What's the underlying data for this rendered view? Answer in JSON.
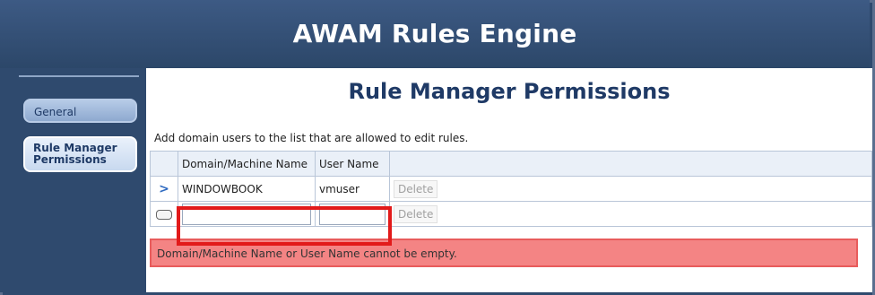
{
  "app": {
    "title": "AWAM Rules Engine"
  },
  "sidebar": {
    "items": [
      {
        "label": "General"
      },
      {
        "label_line1": "Rule Manager",
        "label_line2": "Permissions"
      }
    ]
  },
  "main": {
    "page_title": "Rule Manager Permissions",
    "instruction": "Add domain users to the list that are allowed to edit rules.",
    "table": {
      "columns": [
        "Domain/Machine Name",
        "User Name"
      ],
      "rows": [
        {
          "domain": "WINDOWBOOK",
          "user": "vmuser",
          "action": "Delete"
        }
      ],
      "new_row": {
        "domain_value": "",
        "user_value": "",
        "action": "Delete"
      }
    },
    "error_message": "Domain/Machine Name or User Name cannot be empty."
  },
  "colors": {
    "header_bg": "#2f4a6e",
    "title_text": "#1f3a66",
    "error_bg": "#f48484",
    "highlight": "#e21a1a"
  }
}
